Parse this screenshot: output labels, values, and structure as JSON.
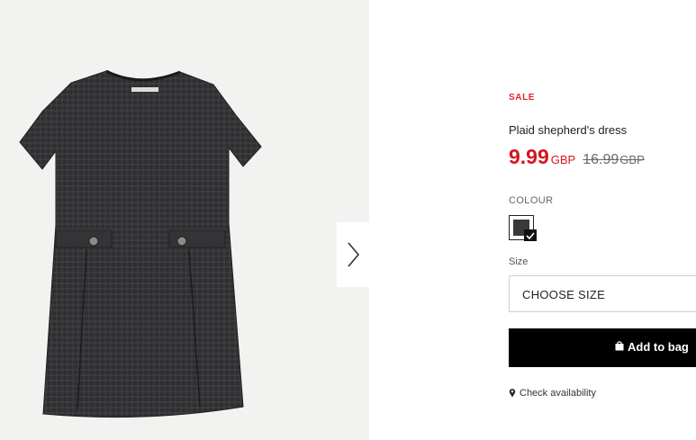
{
  "product": {
    "sale_tag": "SALE",
    "name": "Plaid shepherd's dress",
    "price": {
      "current": "9.99",
      "current_currency": "GBP",
      "original": "16.99",
      "original_currency": "GBP"
    },
    "colour": {
      "label": "COLOUR",
      "selected_swatch_color": "#3a3a3c"
    },
    "size": {
      "label": "Size",
      "placeholder": "CHOOSE SIZE"
    },
    "add_to_bag_label": "Add to bag",
    "check_availability_label": "Check availability"
  },
  "gallery": {
    "product_image_icon": "dress-photo",
    "next_icon": "chevron-right-icon"
  },
  "colors": {
    "sale": "#e0232e",
    "price": "#d5151f",
    "button": "#000000"
  }
}
